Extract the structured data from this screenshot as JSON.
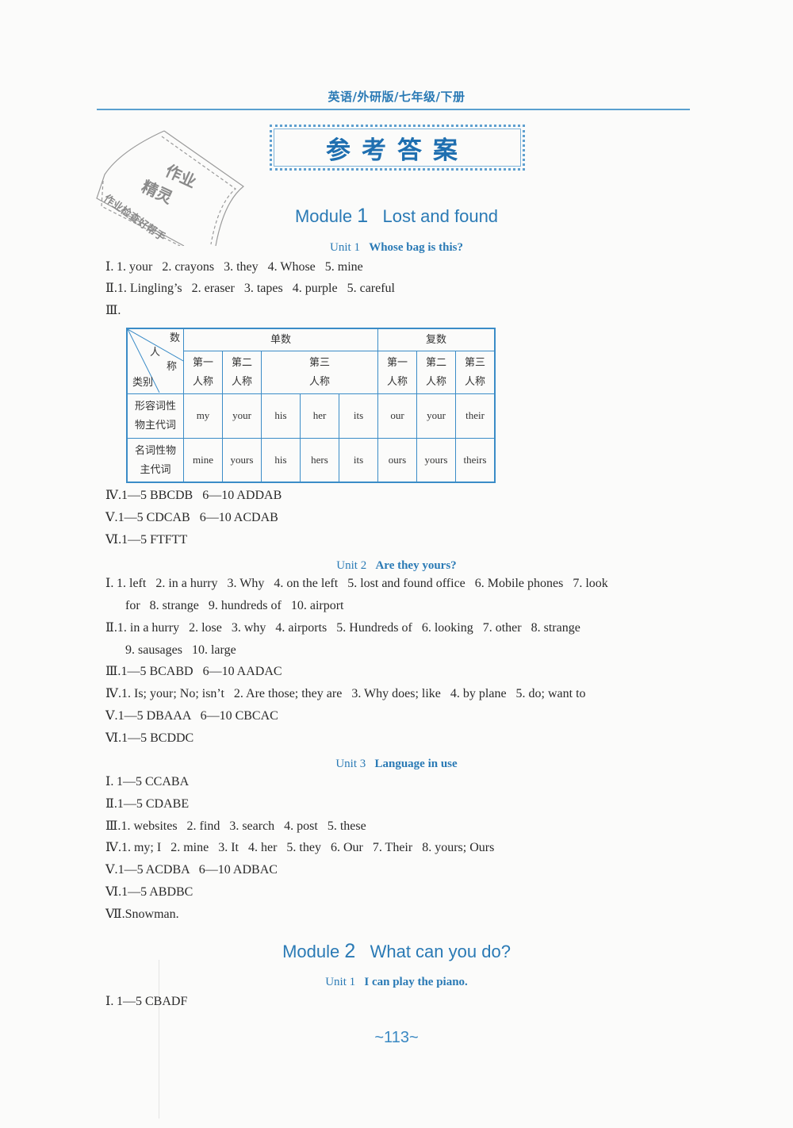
{
  "header": {
    "title": "英语/外研版/七年级/下册"
  },
  "answers_title": "参考答案",
  "stamp": {
    "line1": "作业",
    "line2": "精灵",
    "line3": "作业检查好帮手"
  },
  "modules": [
    {
      "label": "Module",
      "number": "1",
      "title": "Lost and found",
      "units": [
        {
          "label": "Unit",
          "number": "1",
          "title": "Whose bag is this?",
          "answers": [
            {
              "roman": "Ⅰ.",
              "text": "1. your   2. crayons   3. they   4. Whose   5. mine"
            },
            {
              "roman": "Ⅱ.",
              "text": "1. Lingling’s   2. eraser   3. tapes   4. purple   5. careful"
            },
            {
              "roman": "Ⅲ.",
              "text": ""
            },
            {
              "roman": "Ⅳ.",
              "text": "1—5 BBCDB   6—10 ADDAB"
            },
            {
              "roman": "Ⅴ.",
              "text": "1—5 CDCAB   6—10 ACDAB"
            },
            {
              "roman": "Ⅵ.",
              "text": "1—5 FTFTT"
            }
          ],
          "table": {
            "corner": {
              "top": "数",
              "middle1": "人",
              "middle2": "称",
              "bottom": "类别"
            },
            "groups": [
              "单数",
              "复数"
            ],
            "persons_singular": [
              "第一\n人称",
              "第二\n人称",
              "第三\n人称"
            ],
            "persons_plural": [
              "第一\n人称",
              "第二\n人称",
              "第三\n人称"
            ],
            "rows": [
              {
                "label": "形容词性\n物主代词",
                "cells": [
                  "my",
                  "your",
                  "his",
                  "her",
                  "its",
                  "our",
                  "your",
                  "their"
                ]
              },
              {
                "label": "名词性物\n主代词",
                "cells": [
                  "mine",
                  "yours",
                  "his",
                  "hers",
                  "its",
                  "ours",
                  "yours",
                  "theirs"
                ]
              }
            ]
          }
        },
        {
          "label": "Unit",
          "number": "2",
          "title": "Are they yours?",
          "answers": [
            {
              "roman": "Ⅰ.",
              "text": "1. left   2. in a hurry   3. Why   4. on the left   5. lost and found office   6. Mobile phones   7. look",
              "cont": "for   8. strange   9. hundreds of   10. airport"
            },
            {
              "roman": "Ⅱ.",
              "text": "1. in a hurry   2. lose   3. why   4. airports   5. Hundreds of   6. looking   7. other   8. strange",
              "cont": "9. sausages   10. large"
            },
            {
              "roman": "Ⅲ.",
              "text": "1—5 BCABD   6—10 AADAC"
            },
            {
              "roman": "Ⅳ.",
              "text": "1. Is; your; No; isn’t   2. Are those; they are   3. Why does; like   4. by plane   5. do; want to"
            },
            {
              "roman": "Ⅴ.",
              "text": "1—5 DBAAA   6—10 CBCAC"
            },
            {
              "roman": "Ⅵ.",
              "text": "1—5 BCDDC"
            }
          ]
        },
        {
          "label": "Unit",
          "number": "3",
          "title": "Language in use",
          "answers": [
            {
              "roman": "Ⅰ.",
              "text": "1—5 CCABA"
            },
            {
              "roman": "Ⅱ.",
              "text": "1—5 CDABE"
            },
            {
              "roman": "Ⅲ.",
              "text": "1. websites   2. find   3. search   4. post   5. these"
            },
            {
              "roman": "Ⅳ.",
              "text": "1. my; I   2. mine   3. It   4. her   5. they   6. Our   7. Their   8. yours; Ours"
            },
            {
              "roman": "Ⅴ.",
              "text": "1—5 ACDBA   6—10 ADBAC"
            },
            {
              "roman": "Ⅵ.",
              "text": "1—5 ABDBC"
            },
            {
              "roman": "Ⅶ.",
              "text": "Snowman."
            }
          ]
        }
      ]
    },
    {
      "label": "Module",
      "number": "2",
      "title": "What can you do?",
      "units": [
        {
          "label": "Unit",
          "number": "1",
          "title": "I can play the piano.",
          "answers": [
            {
              "roman": "Ⅰ.",
              "text": "1—5 CBADF"
            }
          ]
        }
      ]
    }
  ],
  "page_number": "~113~",
  "colors": {
    "accent_blue": "#2a7ab5",
    "table_border": "#3b8cc7",
    "text": "#2a2a2a"
  }
}
